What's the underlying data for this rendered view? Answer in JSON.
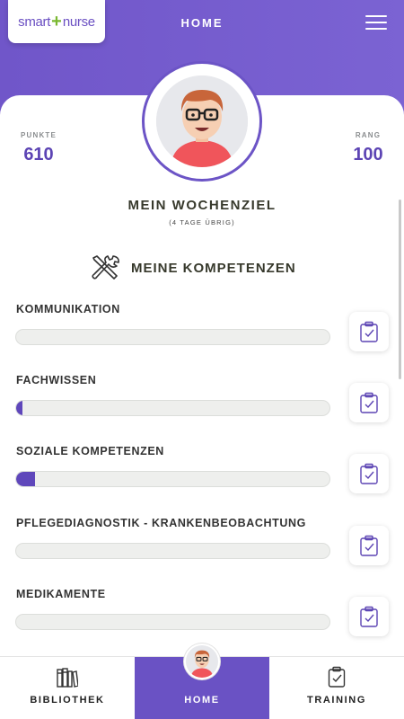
{
  "header": {
    "logo_left": "smart",
    "logo_plus": "+",
    "logo_right": "nurse",
    "title": "HOME",
    "menu_icon": "hamburger-menu-icon"
  },
  "stats": {
    "points_label": "PUNKTE",
    "points_value": "610",
    "rank_label": "RANG",
    "rank_value": "100"
  },
  "goal": {
    "title": "MEIN WOCHENZIEL",
    "subtitle": "(4 TAGE ÜBRIG)"
  },
  "competencies": {
    "title": "MEINE KOMPETENZEN",
    "icon": "tools-icon",
    "items": [
      {
        "name": "KOMMUNIKATION",
        "progress": 0.0
      },
      {
        "name": "FACHWISSEN",
        "progress": 0.02
      },
      {
        "name": "SOZIALE KOMPETENZEN",
        "progress": 0.06
      },
      {
        "name": "PFLEGEDIAGNOSTIK - KRANKENBEOBACHTUNG",
        "progress": 0.0
      },
      {
        "name": "MEDIKAMENTE",
        "progress": 0.0
      }
    ]
  },
  "nav": {
    "items": [
      {
        "label": "BIBLIOTHEK",
        "icon": "library-icon"
      },
      {
        "label": "HOME",
        "icon": "avatar-icon"
      },
      {
        "label": "TRAINING",
        "icon": "clipboard-icon"
      }
    ]
  },
  "colors": {
    "accent": "#6a52c4",
    "logo_green": "#7ab831",
    "bar_bg": "#eeefed"
  }
}
